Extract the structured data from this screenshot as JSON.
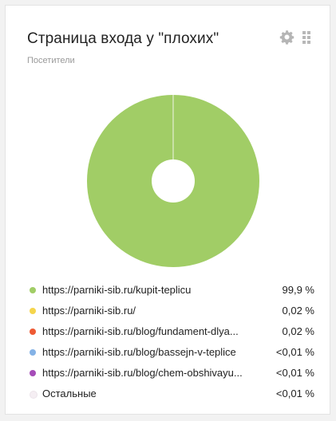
{
  "widget": {
    "title": "Страница входа у \"плохих\"",
    "subtitle": "Посетители"
  },
  "icons": {
    "settings": "gear-icon",
    "drag": "drag-handle-icon"
  },
  "chart_data": {
    "type": "pie",
    "donut": true,
    "title": "",
    "slices": [
      {
        "label": "https://parniki-sib.ru/kupit-teplicu",
        "value": 99.9,
        "color": "#a1cd66"
      },
      {
        "label": "https://parniki-sib.ru/",
        "value": 0.02,
        "color": "#f5d54c"
      },
      {
        "label": "https://parniki-sib.ru/blog/fundament-dlya...",
        "value": 0.02,
        "color": "#ee5a34"
      },
      {
        "label": "https://parniki-sib.ru/blog/bassejn-v-teplice",
        "value": 0.01,
        "color": "#84b2e6"
      },
      {
        "label": "https://parniki-sib.ru/blog/chem-obshivayu...",
        "value": 0.01,
        "color": "#a54cb8"
      },
      {
        "label": "Остальные",
        "value": 0.01,
        "color": "#f5eef3"
      }
    ]
  },
  "legend": [
    {
      "label": "https://parniki-sib.ru/kupit-teplicu",
      "value": "99,9 %",
      "color": "#a1cd66"
    },
    {
      "label": "https://parniki-sib.ru/",
      "value": "0,02 %",
      "color": "#f5d54c"
    },
    {
      "label": "https://parniki-sib.ru/blog/fundament-dlya...",
      "value": "0,02 %",
      "color": "#ee5a34"
    },
    {
      "label": "https://parniki-sib.ru/blog/bassejn-v-teplice",
      "value": "<0,01 %",
      "color": "#84b2e6"
    },
    {
      "label": "https://parniki-sib.ru/blog/chem-obshivayu...",
      "value": "<0,01 %",
      "color": "#a54cb8"
    },
    {
      "label": "Остальные",
      "value": "<0,01 %",
      "color": "#f5eef3"
    }
  ]
}
